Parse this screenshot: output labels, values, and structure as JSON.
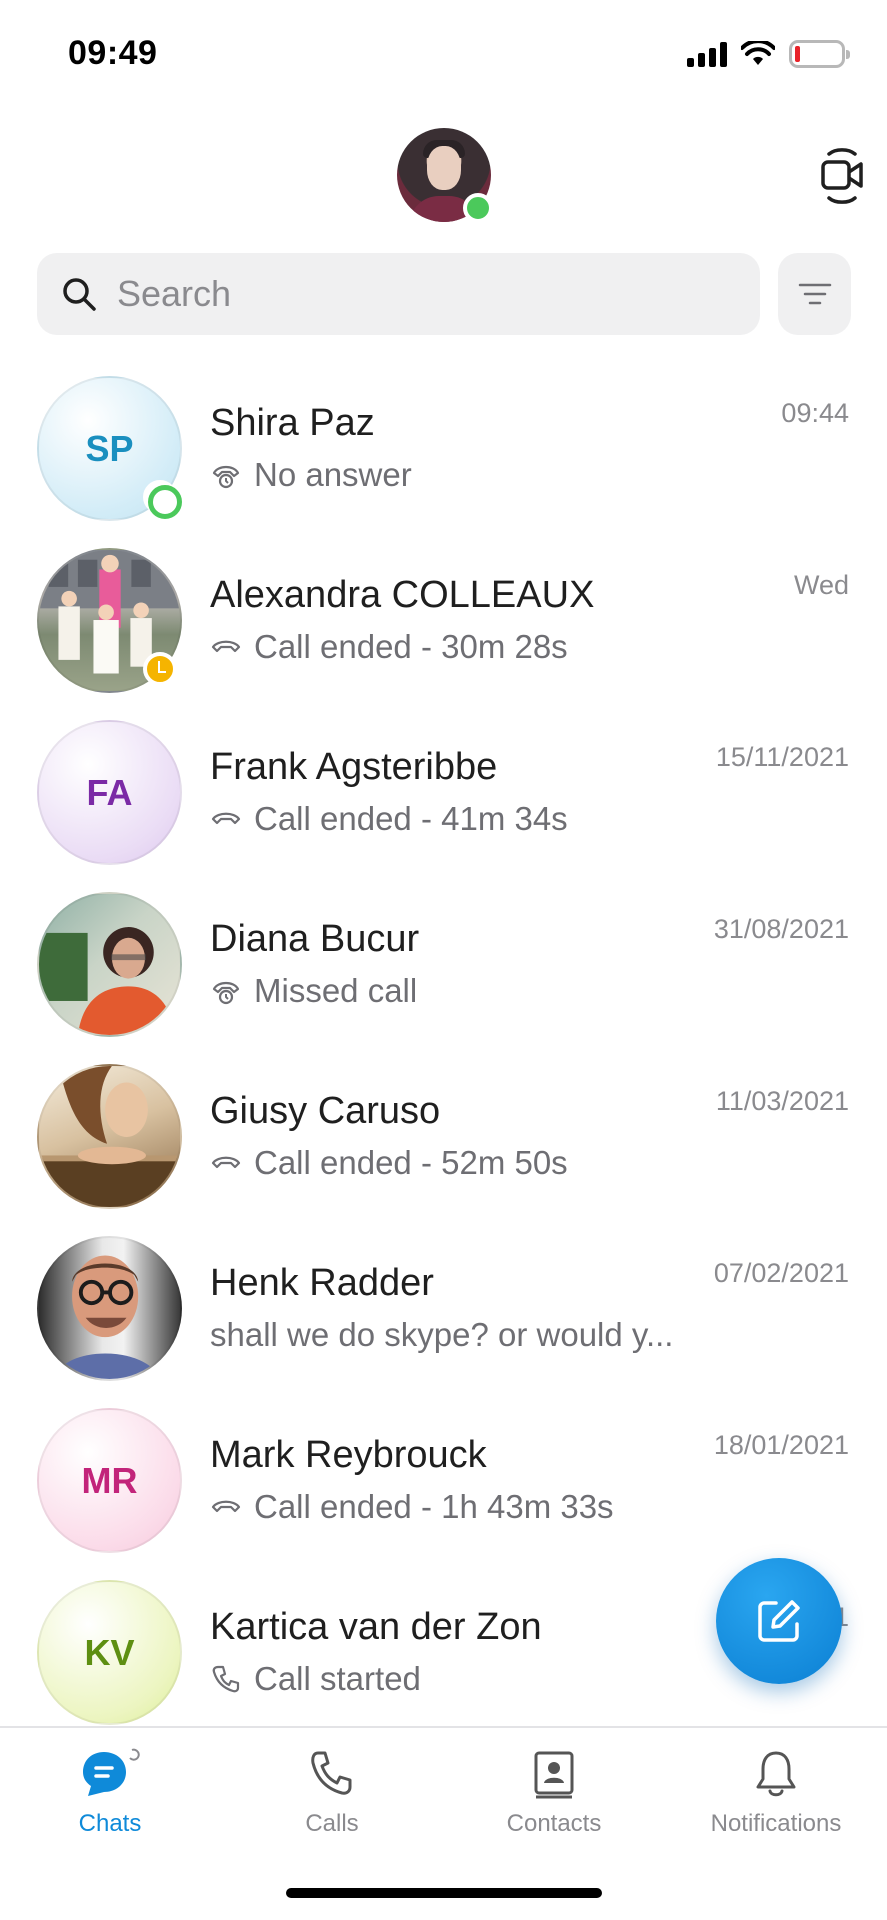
{
  "status_bar": {
    "time": "09:49"
  },
  "search": {
    "placeholder": "Search"
  },
  "chats": [
    {
      "name": "Shira Paz",
      "initials": "SP",
      "subtitle": "No answer",
      "icon": "missed-call-icon",
      "date": "09:44",
      "presence": "online",
      "initials_color": "#1a8fbf"
    },
    {
      "name": "Alexandra COLLEAUX",
      "initials": "",
      "subtitle": "Call ended - 30m 28s",
      "icon": "call-ended-icon",
      "date": "Wed",
      "presence": "away"
    },
    {
      "name": "Frank Agsteribbe",
      "initials": "FA",
      "subtitle": "Call ended - 41m 34s",
      "icon": "call-ended-icon",
      "date": "15/11/2021",
      "initials_color": "#7b2aa6"
    },
    {
      "name": "Diana Bucur",
      "initials": "",
      "subtitle": "Missed call",
      "icon": "missed-call-icon",
      "date": "31/08/2021"
    },
    {
      "name": "Giusy Caruso",
      "initials": "",
      "subtitle": "Call ended - 52m 50s",
      "icon": "call-ended-icon",
      "date": "11/03/2021"
    },
    {
      "name": "Henk Radder",
      "initials": "",
      "subtitle": "shall we do skype? or would y...",
      "icon": "",
      "date": "07/02/2021"
    },
    {
      "name": "Mark Reybrouck",
      "initials": "MR",
      "subtitle": "Call ended - 1h 43m 33s",
      "icon": "call-ended-icon",
      "date": "18/01/2021",
      "initials_color": "#c2247a"
    },
    {
      "name": "Kartica van der Zon",
      "initials": "KV",
      "subtitle": "Call started",
      "icon": "call-started-icon",
      "date": "1",
      "initials_color": "#5e8f12"
    }
  ],
  "nav": [
    {
      "label": "Chats",
      "icon": "chat-bubble-icon",
      "active": true
    },
    {
      "label": "Calls",
      "icon": "phone-icon",
      "active": false
    },
    {
      "label": "Contacts",
      "icon": "contacts-icon",
      "active": false
    },
    {
      "label": "Notifications",
      "icon": "bell-icon",
      "active": false
    }
  ],
  "colors": {
    "accent": "#0f8ad9",
    "online": "#4bc95b",
    "away": "#f5b400"
  }
}
